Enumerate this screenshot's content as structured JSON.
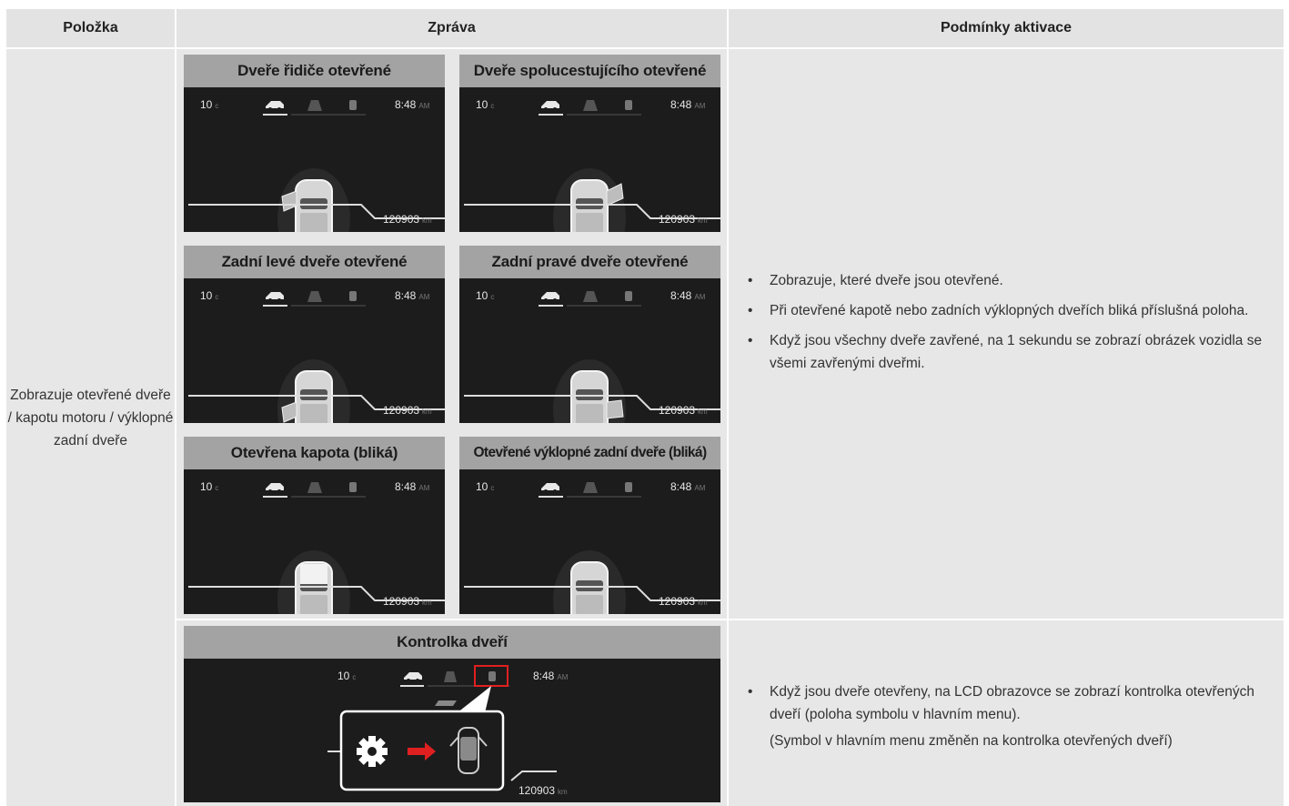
{
  "table": {
    "headers": [
      "Položka",
      "Zpráva",
      "Podmínky aktivace"
    ],
    "item_label": "Zobrazuje otevřené dveře / kapotu motoru / výklopné zadní dveře",
    "panel_titles": [
      "Dveře řidiče otevřené",
      "Dveře spolucestujícího otevřené",
      "Zadní levé dveře otevřené",
      "Zadní pravé dveře otevřené",
      "Otevřena kapota (bliká)",
      "Otevřené výklopné zadní dveře (bliká)"
    ],
    "indicator_title": "Kontrolka dveří",
    "conditions_1": [
      "Zobrazuje, které dveře jsou otevřené.",
      "Při otevřené kapotě nebo zadních výklopných dveřích bliká příslušná poloha.",
      "Když jsou všechny dveře zavřené, na 1 sekundu se zobrazí obrázek vozidla se všemi zavřenými dveřmi."
    ],
    "conditions_2": [
      "Když jsou dveře otevřeny, na LCD obrazovce se zobrazí kontrolka otevřených dveří (poloha symbolu v hlavním menu)."
    ],
    "conditions_2_note": "(Symbol v hlavním menu změněn na kontrolka otevřených dveří)"
  },
  "display": {
    "temp_value": "10",
    "temp_unit": "c",
    "clock_value": "8:48",
    "clock_unit": "AM",
    "odo_value": "120903",
    "odo_unit": "km"
  },
  "icons": [
    "car-side-icon",
    "road-lanes-icon",
    "car-door-icon",
    "gear-icon",
    "red-arrow-icon",
    "car-open-doors-icon"
  ],
  "colors": {
    "accent_red": "#e02020",
    "header_bg": "#e3e3e3",
    "cell_bg": "#e7e7e7",
    "panel_bg": "#1c1c1c"
  }
}
